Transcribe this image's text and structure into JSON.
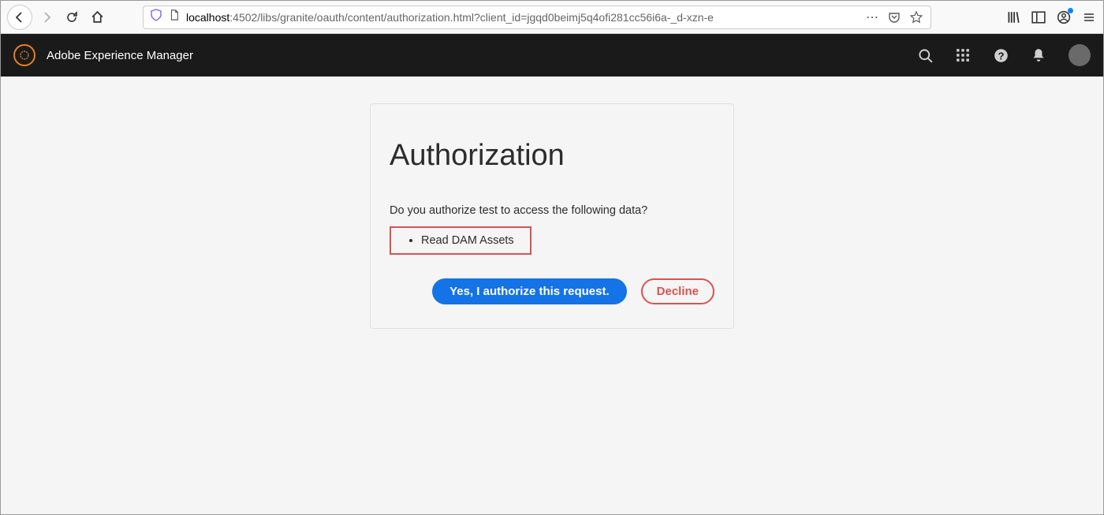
{
  "browser": {
    "url_host": "localhost",
    "url_rest": ":4502/libs/granite/oauth/content/authorization.html?client_id=jgqd0beimj5q4ofi281cc56i6a-_d-xzn-e"
  },
  "header": {
    "title": "Adobe Experience Manager"
  },
  "auth": {
    "heading": "Authorization",
    "prompt": "Do you authorize test to access the following data?",
    "scopes": [
      "Read DAM Assets"
    ],
    "authorize_label": "Yes, I authorize this request.",
    "decline_label": "Decline"
  }
}
